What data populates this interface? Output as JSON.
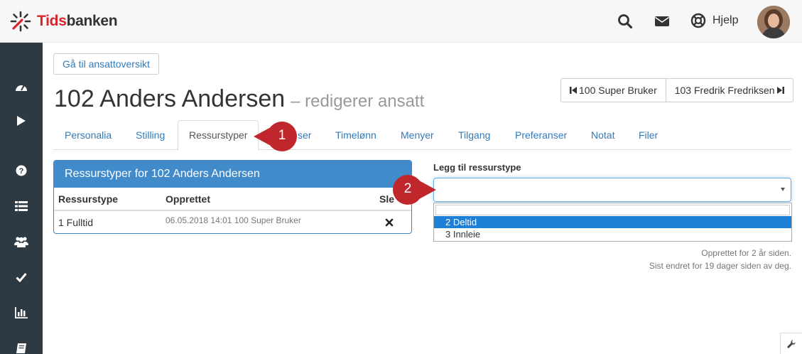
{
  "brand": {
    "name_prefix": "Tids",
    "name_suffix": "banken",
    "accent": "#d9262e"
  },
  "topbar": {
    "help_label": "Hjelp",
    "icons": [
      "search-icon",
      "envelope-icon",
      "lifebuoy-icon"
    ]
  },
  "sidebar": {
    "icons": [
      "dashboard-icon",
      "play-icon",
      "question-icon",
      "list-icon",
      "users-icon",
      "check-icon",
      "bar-chart-icon",
      "book-icon"
    ]
  },
  "overview_button": "Gå til ansattoversikt",
  "page": {
    "title": "102 Anders Andersen",
    "subtitle": "– redigerer ansatt"
  },
  "pager": {
    "prev": "100 Super Bruker",
    "next": "103 Fredrik Fredriksen"
  },
  "tabs": [
    {
      "label": "Personalia"
    },
    {
      "label": "Stilling"
    },
    {
      "label": "Ressurstyper"
    },
    {
      "label": "ser"
    },
    {
      "label": "Timelønn"
    },
    {
      "label": "Menyer"
    },
    {
      "label": "Tilgang"
    },
    {
      "label": "Preferanser"
    },
    {
      "label": "Notat"
    },
    {
      "label": "Filer"
    }
  ],
  "panel": {
    "heading": "Ressurstyper for 102 Anders Andersen",
    "columns": [
      "Ressurstype",
      "Opprettet",
      "Sle"
    ],
    "rows": [
      {
        "type": "1 Fulltid",
        "created": "06.05.2018 14:01 100 Super Bruker"
      }
    ]
  },
  "form": {
    "label": "Legg til ressurstype",
    "selected": "",
    "options": [
      "2 Deltid",
      "3 Innleie"
    ],
    "highlighted_index": 0
  },
  "meta": {
    "created": "Opprettet for 2 år siden.",
    "updated": "Sist endret for 19 dager siden av deg."
  },
  "callouts": [
    "1",
    "2"
  ],
  "colors": {
    "link": "#337ab7",
    "panel": "#428bca",
    "sidebar": "#2d3a43",
    "callout": "#c0272d"
  }
}
